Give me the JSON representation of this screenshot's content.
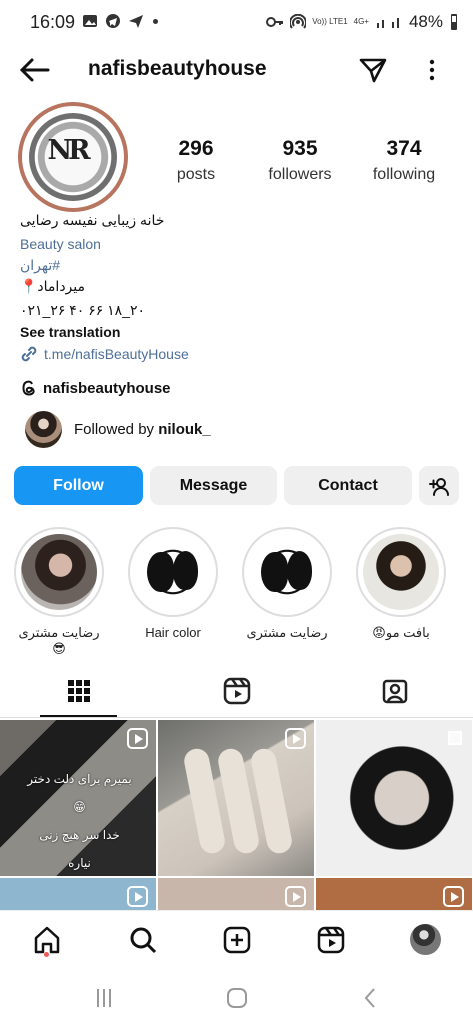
{
  "status": {
    "time": "16:09",
    "battery": "48%",
    "network": "4G+",
    "volte": "Vo)) LTE1",
    "left_icons": [
      "image-icon",
      "telegram-icon",
      "send-icon",
      "dot-icon"
    ],
    "right_icons": [
      "key-icon",
      "hotspot-icon",
      "signal-icon",
      "battery-icon"
    ]
  },
  "header": {
    "username": "nafisbeautyhouse"
  },
  "profile": {
    "avatar_text": "NR",
    "posts": {
      "value": "296",
      "label": "posts"
    },
    "followers": {
      "value": "935",
      "label": "followers"
    },
    "following": {
      "value": "374",
      "label": "following"
    },
    "bio": {
      "name": "خانه زیبایی نفیسه رضایی",
      "category": "Beauty salon",
      "hashtag": "#تهران",
      "location": "میرداماد📍",
      "phone": "۰۲۱_۲۶ ۴۰ ۶۶ ۱۸_۲۰",
      "translation": "See translation",
      "link": "t.me/nafisBeautyHouse"
    },
    "threads": "nafisbeautyhouse",
    "followed_by": {
      "prefix": "Followed by ",
      "name": "nilouk_"
    }
  },
  "actions": {
    "follow": "Follow",
    "message": "Message",
    "contact": "Contact"
  },
  "highlights": [
    {
      "label": "رضایت مشتری😎"
    },
    {
      "label": "Hair color"
    },
    {
      "label": "رضایت مشتری"
    },
    {
      "label": "بافت مو😡"
    }
  ],
  "tabs": [
    "grid-icon",
    "reels-icon",
    "tagged-icon"
  ],
  "posts": {
    "caption_line_1": "بمیرم برای دلت دختر😁",
    "caption_line_2": "خدا سر هیچ زنی نیاره"
  },
  "nav": [
    "home-icon",
    "search-icon",
    "create-icon",
    "reels-icon",
    "profile-icon"
  ],
  "colors": {
    "accent": "#1796f4",
    "link": "#4e6f97",
    "button_bg": "#efefef"
  }
}
